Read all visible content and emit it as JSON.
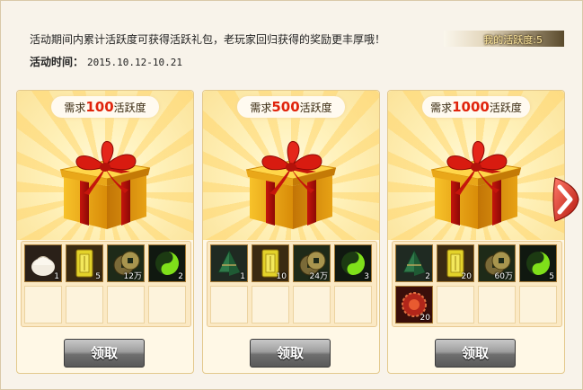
{
  "header": {
    "description": "活动期间内累计活跃度可获得活跃礼包，老玩家回归获得的奖励更丰厚哦！",
    "time_label": "活动时间：",
    "time_value": "2015.10.12-10.21",
    "my_activity": "我的活跃度:5"
  },
  "cards": [
    {
      "req_prefix": "需求",
      "req_value": "100",
      "req_suffix": "活跃度",
      "items": [
        {
          "icon": "dumpling-icon",
          "count": "1"
        },
        {
          "icon": "jade-token-icon",
          "count": "5"
        },
        {
          "icon": "copper-coin-icon",
          "count": "12万"
        },
        {
          "icon": "green-taiji-icon",
          "count": "2"
        }
      ],
      "button": "领取"
    },
    {
      "req_prefix": "需求",
      "req_value": "500",
      "req_suffix": "活跃度",
      "items": [
        {
          "icon": "green-zongzi-icon",
          "count": "1"
        },
        {
          "icon": "jade-token-icon",
          "count": "10"
        },
        {
          "icon": "copper-coin-icon",
          "count": "24万"
        },
        {
          "icon": "green-taiji-icon",
          "count": "3"
        }
      ],
      "button": "领取"
    },
    {
      "req_prefix": "需求",
      "req_value": "1000",
      "req_suffix": "活跃度",
      "items": [
        {
          "icon": "green-zongzi-icon",
          "count": "2"
        },
        {
          "icon": "jade-token-icon",
          "count": "20"
        },
        {
          "icon": "copper-coin-icon",
          "count": "60万"
        },
        {
          "icon": "green-taiji-icon",
          "count": "5"
        },
        {
          "icon": "red-bead-icon",
          "count": "20"
        }
      ],
      "button": "领取"
    }
  ],
  "colors": {
    "accent_red": "#e0240c",
    "card_border": "#e3c98d",
    "button_gray": "#7a7a7a"
  }
}
